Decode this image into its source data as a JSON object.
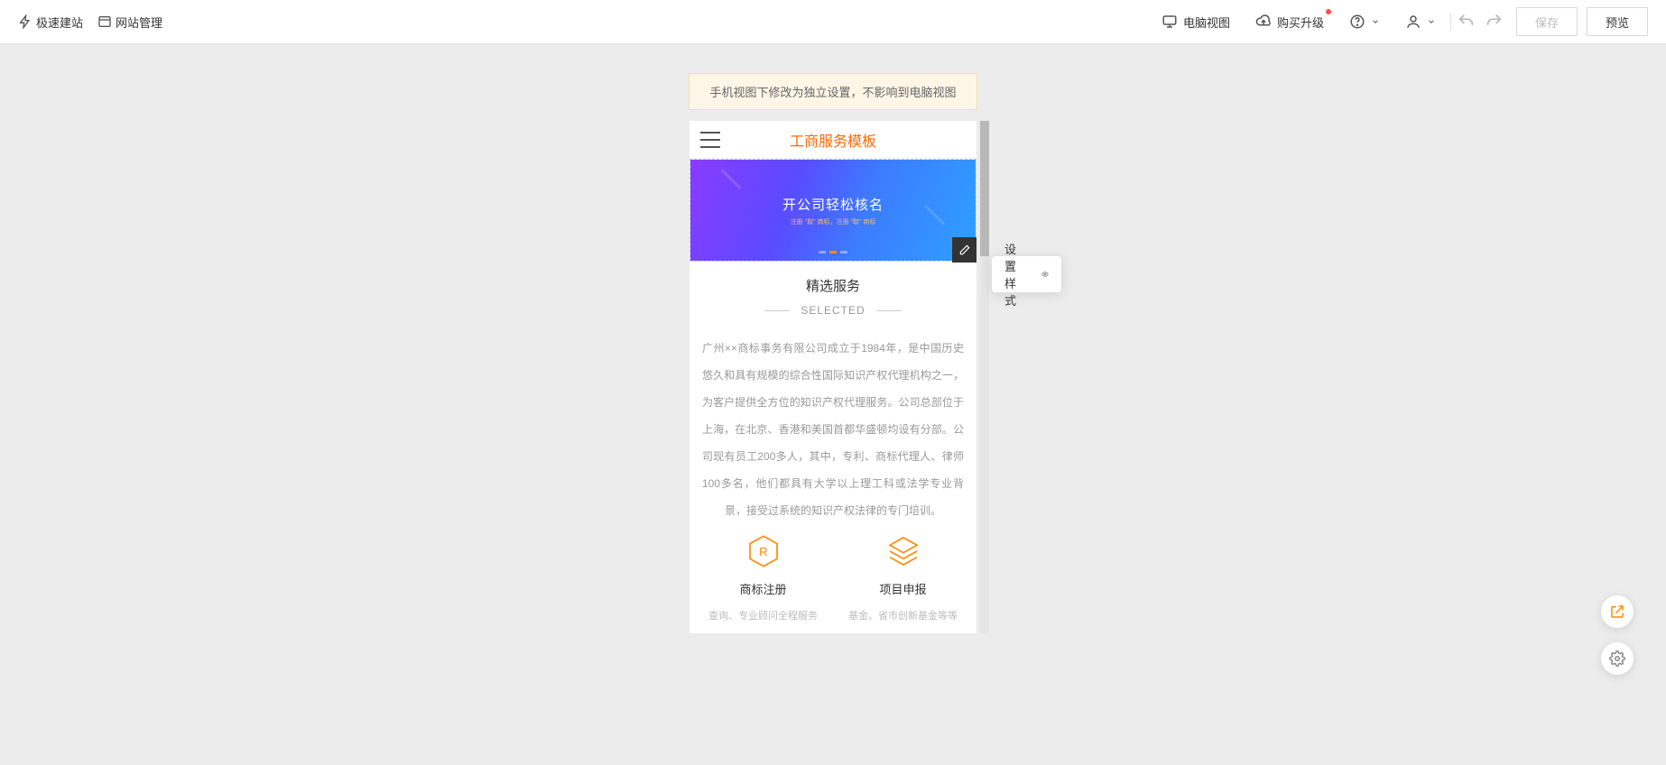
{
  "topbar": {
    "speed_label": "极速建站",
    "manage_label": "网站管理",
    "desktop_view_label": "电脑视图",
    "upgrade_label": "购买升级",
    "save_label": "保存",
    "preview_label": "预览"
  },
  "notice": "手机视图下修改为独立设置，不影响到电脑视图",
  "phone": {
    "title": "工商服务模板",
    "banner": {
      "headline": "开公司轻松核名",
      "subline": "注册 \"取\" 商标，注册 \"取\" 商标"
    },
    "section": {
      "title": "精选服务",
      "subtitle": "SELECTED",
      "desc": "广州××商标事务有限公司成立于1984年，是中国历史悠久和具有规模的综合性国际知识产权代理机构之一，为客户提供全方位的知识产权代理服务。公司总部位于上海，在北京、香港和美国首都华盛顿均设有分部。公司现有员工200多人，其中，专利、商标代理人、律师100多名，他们都具有大学以上理工科或法学专业背景，接受过系统的知识产权法律的专门培训。"
    },
    "services": [
      {
        "name": "商标注册",
        "desc": "查询、专业顾问全程服务"
      },
      {
        "name": "项目申报",
        "desc": "基金、省市创新基金等等"
      }
    ]
  },
  "popover": {
    "style_label": "设置样式"
  }
}
